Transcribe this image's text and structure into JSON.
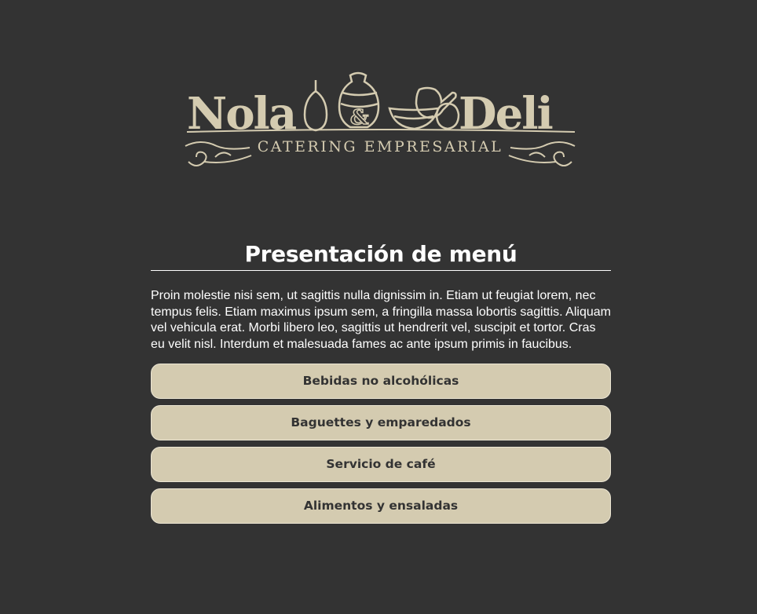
{
  "brand": {
    "name_left": "Nola",
    "ampersand": "&",
    "name_right": "Deli",
    "tagline": "CATERING EMPRESARIAL",
    "color": "#d4cbb0"
  },
  "page": {
    "title": "Presentación de menú",
    "intro": "Proin molestie nisi sem, ut sagittis nulla dignissim in. Etiam ut feugiat lorem, nec tempus felis. Etiam maximus ipsum sem, a fringilla massa lobortis sagittis. Aliquam vel vehicula erat. Morbi libero leo, sagittis ut hendrerit vel, suscipit et tortor. Cras eu velit nisl. Interdum et malesuada fames ac ante ipsum primis in faucibus."
  },
  "menu": {
    "items": [
      {
        "label": "Bebidas no alcohólicas"
      },
      {
        "label": "Baguettes y emparedados"
      },
      {
        "label": "Servicio de café"
      },
      {
        "label": "Alimentos y ensaladas"
      }
    ]
  },
  "colors": {
    "background": "#333333",
    "button": "#d4cbb0",
    "button_text": "#333333",
    "text": "#ffffff"
  }
}
